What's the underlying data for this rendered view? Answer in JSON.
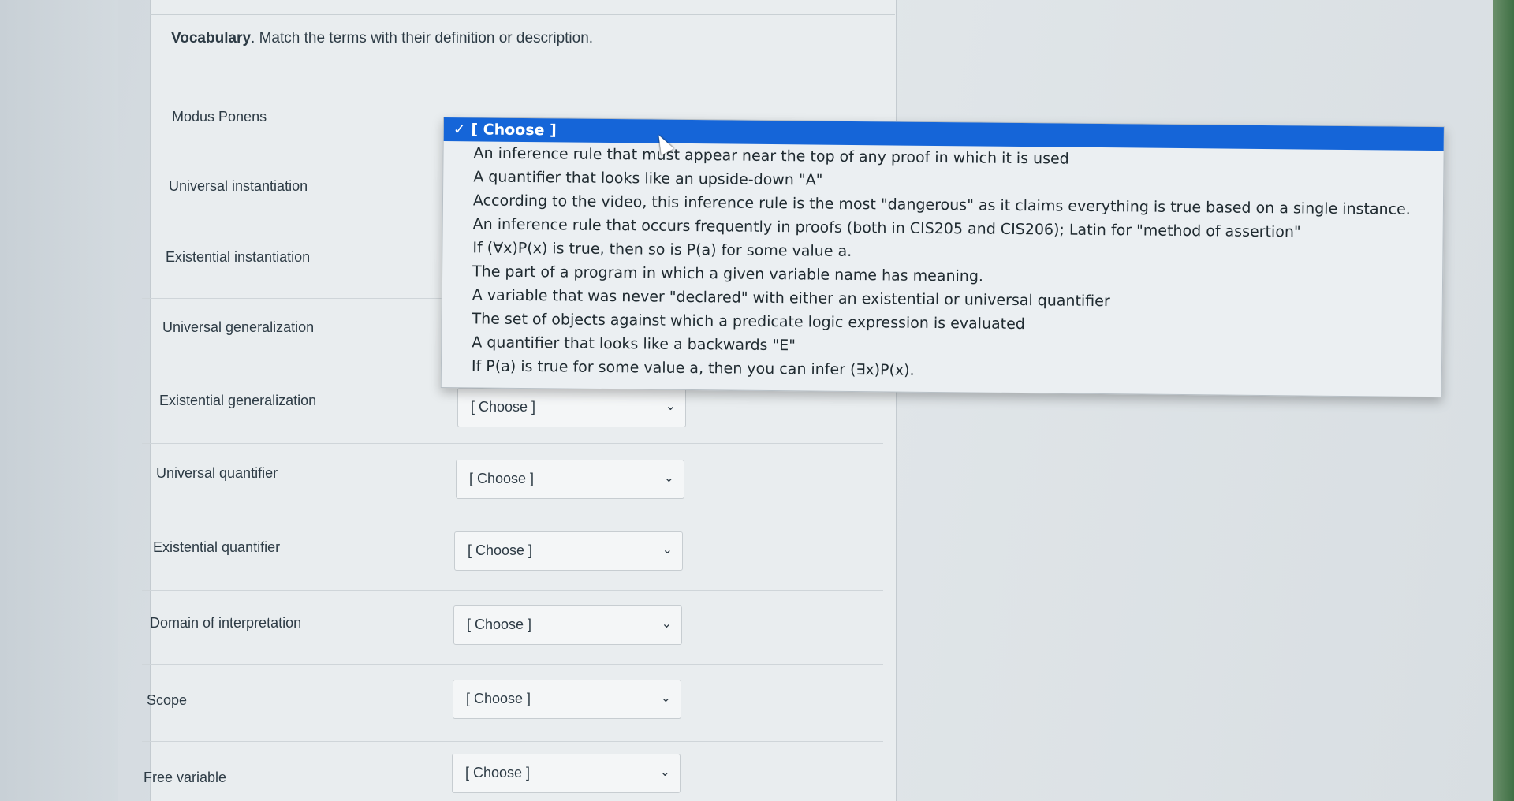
{
  "instructions": {
    "bold": "Vocabulary",
    "text": ". Match the terms with their definition or description."
  },
  "terms": [
    {
      "label": "Modus Ponens",
      "selected": "[ Choose ]"
    },
    {
      "label": "Universal instantiation",
      "selected": "[ Choose ]"
    },
    {
      "label": "Existential instantiation",
      "selected": "[ Choose ]"
    },
    {
      "label": "Universal generalization",
      "selected": "[ Choose ]"
    },
    {
      "label": "Existential generalization",
      "selected": "[ Choose ]"
    },
    {
      "label": "Universal quantifier",
      "selected": "[ Choose ]"
    },
    {
      "label": "Existential quantifier",
      "selected": "[ Choose ]"
    },
    {
      "label": "Domain of interpretation",
      "selected": "[ Choose ]"
    },
    {
      "label": "Scope",
      "selected": "[ Choose ]"
    },
    {
      "label": "Free variable",
      "selected": "[ Choose ]"
    }
  ],
  "dropdown": {
    "options": [
      "✓ [ Choose ]",
      "An inference rule that must appear near the top of any proof in which it is used",
      "A quantifier that looks like an upside-down \"A\"",
      "According to the video, this inference rule is the most \"dangerous\" as it claims everything is true based on a single instance.",
      "An inference rule that occurs frequently in proofs (both in CIS205 and CIS206); Latin for \"method of assertion\"",
      "If (∀x)P(x) is true, then so is P(a) for some value a.",
      "The part of a program in which a given variable name has meaning.",
      "A variable that was never \"declared\" with either an existential or universal quantifier",
      "The set of objects against which a predicate logic expression is evaluated",
      "A quantifier that looks like a backwards \"E\"",
      "If P(a) is true for some value a, then you can infer (∃x)P(x)."
    ]
  },
  "icons": {
    "chevron": "chevron-down-icon"
  }
}
